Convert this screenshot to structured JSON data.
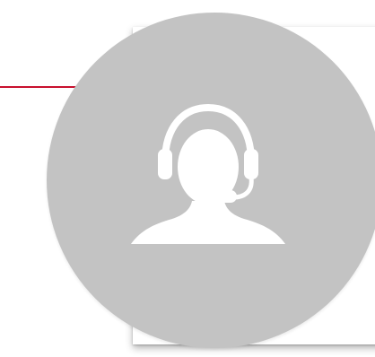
{
  "colors": {
    "accent": "#c8102e",
    "circle": "#c3c3c3",
    "icon": "#ffffff",
    "background": "#ffffff"
  },
  "icon": "customer-support-headset-icon"
}
